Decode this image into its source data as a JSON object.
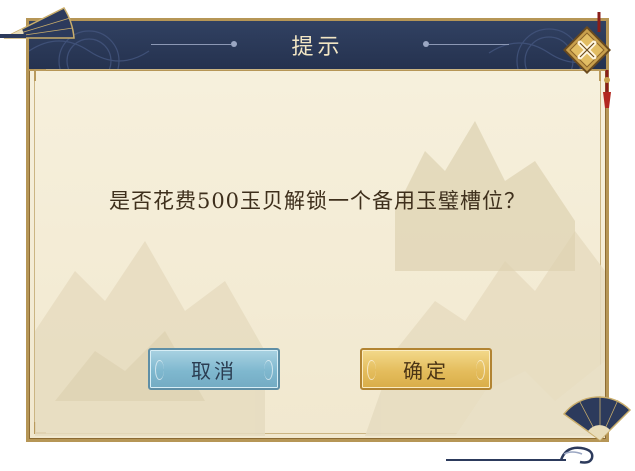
{
  "dialog": {
    "title": "提示",
    "message": "是否花费500玉贝解锁一个备用玉璧槽位？",
    "cancel_label": "取消",
    "confirm_label": "确定"
  },
  "icons": {
    "close": "close-icon",
    "fan_top_left": "folding-fan-icon",
    "fan_bottom_right": "folding-fan-icon"
  },
  "colors": {
    "title_bar": "#2b3856",
    "panel": "#f3ebd4",
    "border_gold": "#b69656",
    "cancel_button": "#86bcd3",
    "confirm_button": "#e6c265",
    "message_text": "#3e2f1c"
  }
}
